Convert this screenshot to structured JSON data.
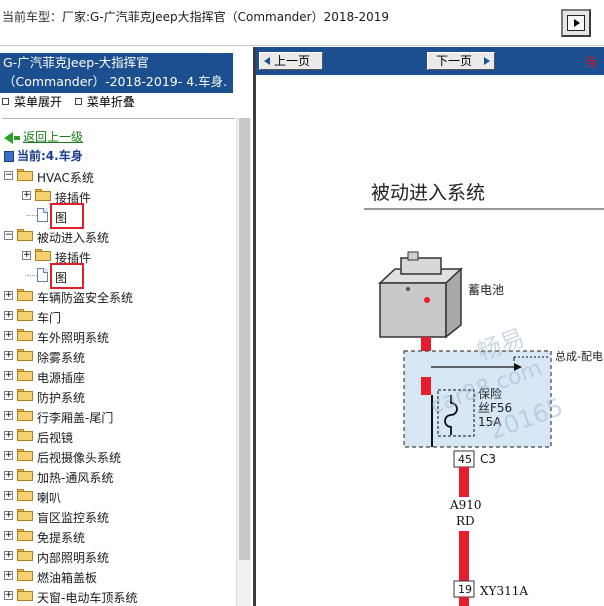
{
  "top": {
    "label": "当前车型：",
    "value": "厂家:G-广汽菲克Jeep大指挥官（Commander）2018-2019"
  },
  "left": {
    "header_line1": "G-广汽菲克Jeep-大指挥官",
    "header_line2": "（Commander）-2018-2019- 4.车身.",
    "menu_expand": "菜单展开",
    "menu_collapse": "菜单折叠",
    "back": "返回上一级",
    "current": "当前:4.车身",
    "tree": [
      {
        "label": "HVAC系统",
        "level": 0,
        "type": "folder",
        "toggle": "-"
      },
      {
        "label": "接插件",
        "level": 1,
        "type": "folder",
        "toggle": "+"
      },
      {
        "label": "图",
        "level": 1,
        "type": "doc",
        "toggle": ""
      },
      {
        "label": "被动进入系统",
        "level": 0,
        "type": "folder",
        "toggle": "-"
      },
      {
        "label": "接插件",
        "level": 1,
        "type": "folder",
        "toggle": "+"
      },
      {
        "label": "图",
        "level": 1,
        "type": "doc",
        "toggle": ""
      },
      {
        "label": "车辆防盗安全系统",
        "level": 0,
        "type": "folder",
        "toggle": "+"
      },
      {
        "label": "车门",
        "level": 0,
        "type": "folder",
        "toggle": "+"
      },
      {
        "label": "车外照明系统",
        "level": 0,
        "type": "folder",
        "toggle": "+"
      },
      {
        "label": "除雾系统",
        "level": 0,
        "type": "folder",
        "toggle": "+"
      },
      {
        "label": "电源插座",
        "level": 0,
        "type": "folder",
        "toggle": "+"
      },
      {
        "label": "防护系统",
        "level": 0,
        "type": "folder",
        "toggle": "+"
      },
      {
        "label": "行李厢盖-尾门",
        "level": 0,
        "type": "folder",
        "toggle": "+"
      },
      {
        "label": "后视镜",
        "level": 0,
        "type": "folder",
        "toggle": "+"
      },
      {
        "label": "后视摄像头系统",
        "level": 0,
        "type": "folder",
        "toggle": "+"
      },
      {
        "label": "加热-通风系统",
        "level": 0,
        "type": "folder",
        "toggle": "+"
      },
      {
        "label": "喇叭",
        "level": 0,
        "type": "folder",
        "toggle": "+"
      },
      {
        "label": "盲区监控系统",
        "level": 0,
        "type": "folder",
        "toggle": "+"
      },
      {
        "label": "免提系统",
        "level": 0,
        "type": "folder",
        "toggle": "+"
      },
      {
        "label": "内部照明系统",
        "level": 0,
        "type": "folder",
        "toggle": "+"
      },
      {
        "label": "燃油箱盖板",
        "level": 0,
        "type": "folder",
        "toggle": "+"
      },
      {
        "label": "天窗-电动车顶系统",
        "level": 0,
        "type": "folder",
        "toggle": "+"
      }
    ]
  },
  "nav": {
    "prev": "上一页",
    "next": "下一页",
    "red_tag": "当"
  },
  "diagram": {
    "title": "被动进入系统",
    "battery": "蓄电池",
    "box_label": "总成-配电",
    "fuse_line1": "保险",
    "fuse_line2": "丝F56",
    "fuse_line3": "15A",
    "c3_num": "45",
    "c3": "C3",
    "wire1": "A910",
    "wire2": "RD",
    "conn_num": "19",
    "conn": "XY311A",
    "conn_num2": "19",
    "watermark1": "畅易",
    "watermark2": "car88.com",
    "watermark3": "20165"
  },
  "colors": {
    "navy": "#1b4f8f",
    "wire_red": "#e81c2c",
    "box_fill": "#d8e7f5",
    "highlight_red": "#e0202a"
  }
}
